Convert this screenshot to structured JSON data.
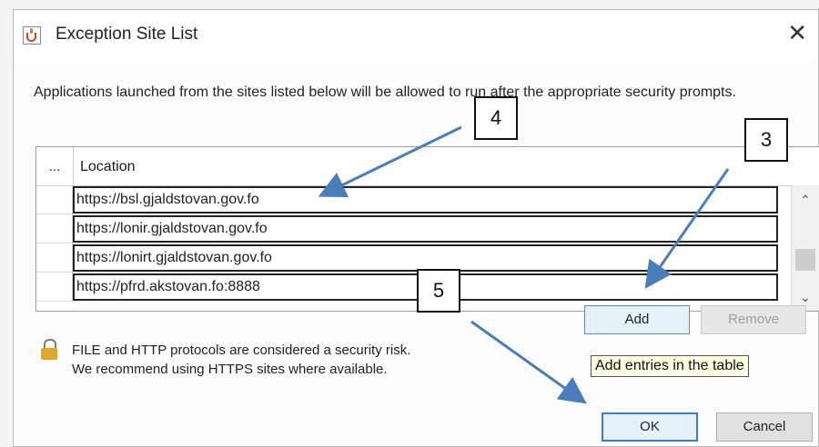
{
  "window": {
    "title": "Exception Site List",
    "close_glyph": "✕"
  },
  "description": "Applications launched from the sites listed below will be allowed to run after the appropriate security prompts.",
  "table": {
    "headers": {
      "row_marker": "...",
      "location": "Location"
    },
    "rows": [
      "https://bsl.gjaldstovan.gov.fo",
      "https://lonir.gjaldstovan.gov.fo",
      "https://lonirt.gjaldstovan.gov.fo",
      "https://pfrd.akstovan.fo:8888"
    ]
  },
  "buttons": {
    "add": "Add",
    "remove": "Remove",
    "ok": "OK",
    "cancel": "Cancel"
  },
  "tooltip": "Add entries in the table",
  "warning": {
    "line1": "FILE and HTTP protocols are considered a security risk.",
    "line2": "We recommend using HTTPS sites where available."
  },
  "callouts": {
    "c3": "3",
    "c4": "4",
    "c5": "5"
  },
  "icons": {
    "title": "java-icon",
    "warning": "lock-icon",
    "scroll_up": "chevron-up-icon",
    "scroll_down": "chevron-down-icon"
  },
  "colors": {
    "annotation_arrow": "#4a7ebb",
    "ok_border": "#3a7bd5"
  }
}
